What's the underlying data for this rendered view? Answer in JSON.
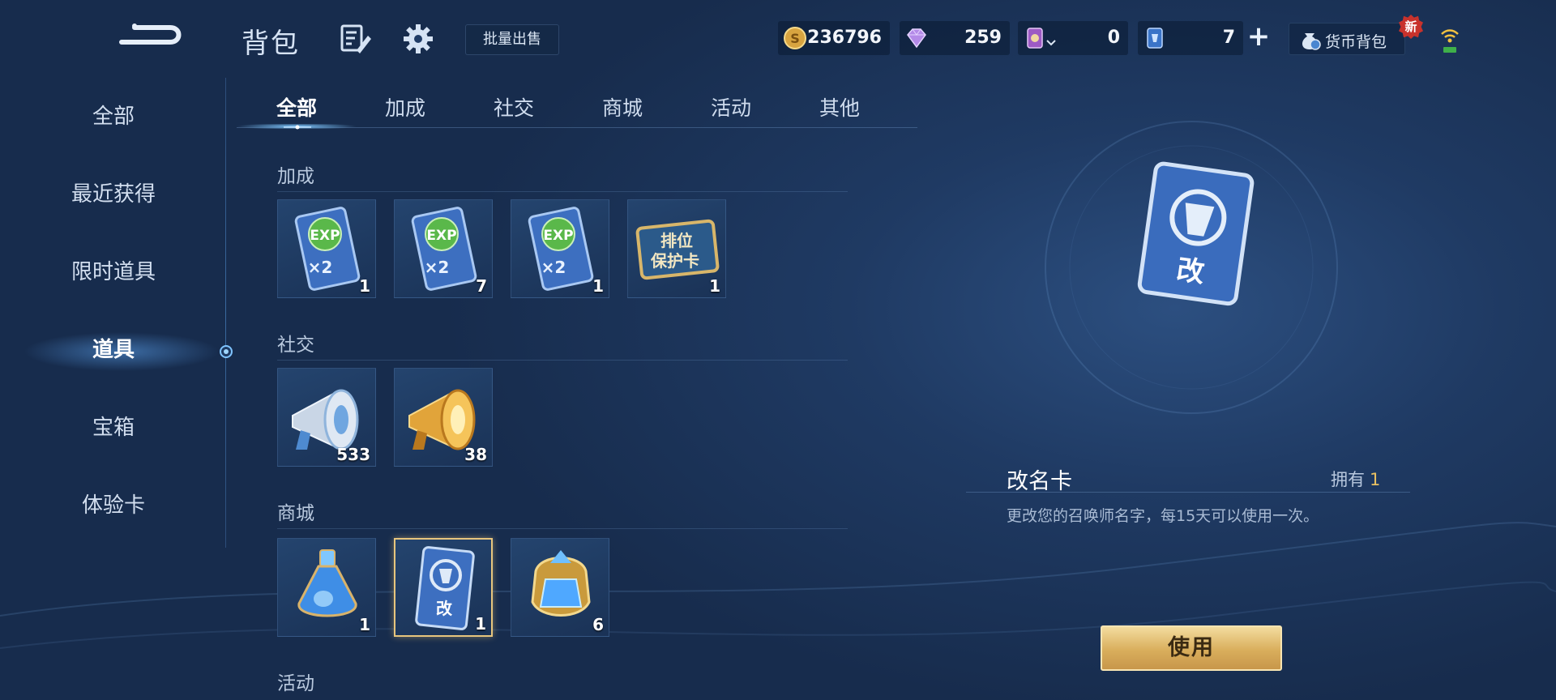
{
  "header": {
    "title": "背包",
    "bulk_sell": "批量出售",
    "currencies": {
      "gold": "236796",
      "diamond": "259",
      "coupon": "0",
      "card": "7"
    },
    "wallet_label": "货币背包",
    "new_badge": "新"
  },
  "sidebar": {
    "items": [
      {
        "label": "全部"
      },
      {
        "label": "最近获得"
      },
      {
        "label": "限时道具"
      },
      {
        "label": "道具"
      },
      {
        "label": "宝箱"
      },
      {
        "label": "体验卡"
      }
    ],
    "active_index": 3
  },
  "tabs": {
    "items": [
      {
        "label": "全部"
      },
      {
        "label": "加成"
      },
      {
        "label": "社交"
      },
      {
        "label": "商城"
      },
      {
        "label": "活动"
      },
      {
        "label": "其他"
      }
    ],
    "active_index": 0
  },
  "sections": [
    {
      "title": "加成",
      "items": [
        {
          "icon": "exp-x2-card-icon",
          "count": "1"
        },
        {
          "icon": "exp-x2-card-icon",
          "count": "7"
        },
        {
          "icon": "exp-x2-card-icon",
          "count": "1"
        },
        {
          "icon": "rank-protection-card-icon",
          "count": "1",
          "art_text_line1": "排位",
          "art_text_line2": "保护卡"
        }
      ]
    },
    {
      "title": "社交",
      "items": [
        {
          "icon": "silver-megaphone-icon",
          "count": "533"
        },
        {
          "icon": "gold-megaphone-icon",
          "count": "38"
        }
      ]
    },
    {
      "title": "商城",
      "items": [
        {
          "icon": "potion-bottle-icon",
          "count": "1"
        },
        {
          "icon": "rename-card-icon",
          "count": "1",
          "selected": true
        },
        {
          "icon": "blue-crystal-icon",
          "count": "6"
        }
      ]
    },
    {
      "title": "活动",
      "items": []
    }
  ],
  "detail": {
    "name": "改名卡",
    "owned_label": "拥有",
    "owned_count": "1",
    "description": "更改您的召唤师名字，每15天可以使用一次。",
    "use_button": "使用",
    "art_char": "改"
  },
  "colors": {
    "accent_gold": "#e8c062",
    "selected_border": "#e7c57d",
    "background": "#1f3a63"
  }
}
